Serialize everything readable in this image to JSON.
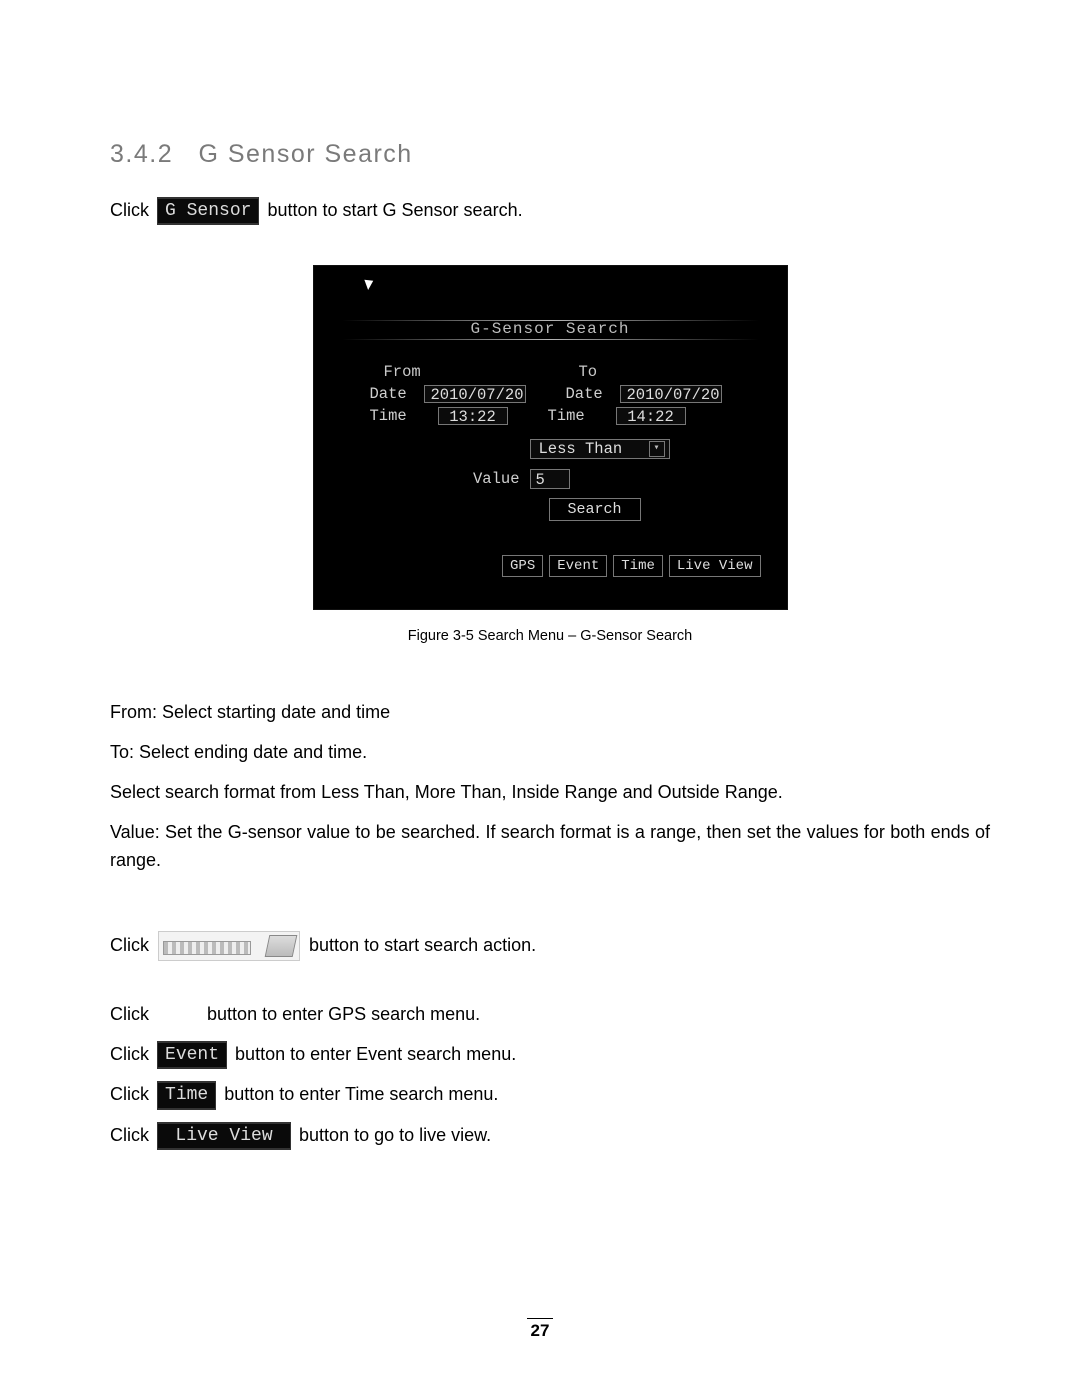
{
  "section": {
    "number": "3.4.2",
    "title": "G Sensor Search"
  },
  "intro": {
    "click": "Click",
    "chip_label": "G Sensor",
    "rest": "button to start G Sensor search."
  },
  "osd": {
    "title": "G-Sensor Search",
    "from_label": "From",
    "to_label": "To",
    "date_label": "Date",
    "time_label": "Time",
    "from_date": "2010/07/20",
    "from_time": "13:22",
    "to_date": "2010/07/20",
    "to_time": "14:22",
    "combo_label": "Less Than",
    "value_label": "Value",
    "value": "5",
    "search_btn": "Search",
    "bottom": {
      "gps": "GPS",
      "event": "Event",
      "time": "Time",
      "live_view": "Live View"
    }
  },
  "caption": "Figure 3-5 Search Menu – G-Sensor Search",
  "descriptions": {
    "from_label": "From:",
    "from_text": "Select starting date and time",
    "to_label": "To:",
    "to_text": "Select ending date and time.",
    "format_text_pre": "Select search format from ",
    "format_opts": "Less Than, More Than, Inside Range",
    "format_and": " and ",
    "format_last": "Outside Range",
    "format_period": ".",
    "value_label": "Value:",
    "value_text": "Set the G-sensor value to be searched. If search format is a range, then set the values for both ends of range."
  },
  "actions": {
    "search": {
      "pre": "Click",
      "post": "button to start search action."
    },
    "gps": {
      "pre": "Click",
      "post": "button to enter GPS search menu."
    },
    "event": {
      "pre": "Click",
      "chip": "Event",
      "post": "button to enter Event search menu."
    },
    "time": {
      "pre": "Click",
      "chip": "Time",
      "post": "button to enter Time search menu."
    },
    "live": {
      "pre": "Click",
      "chip": "Live View",
      "post": "button to go to live view."
    }
  },
  "page_number": "27"
}
